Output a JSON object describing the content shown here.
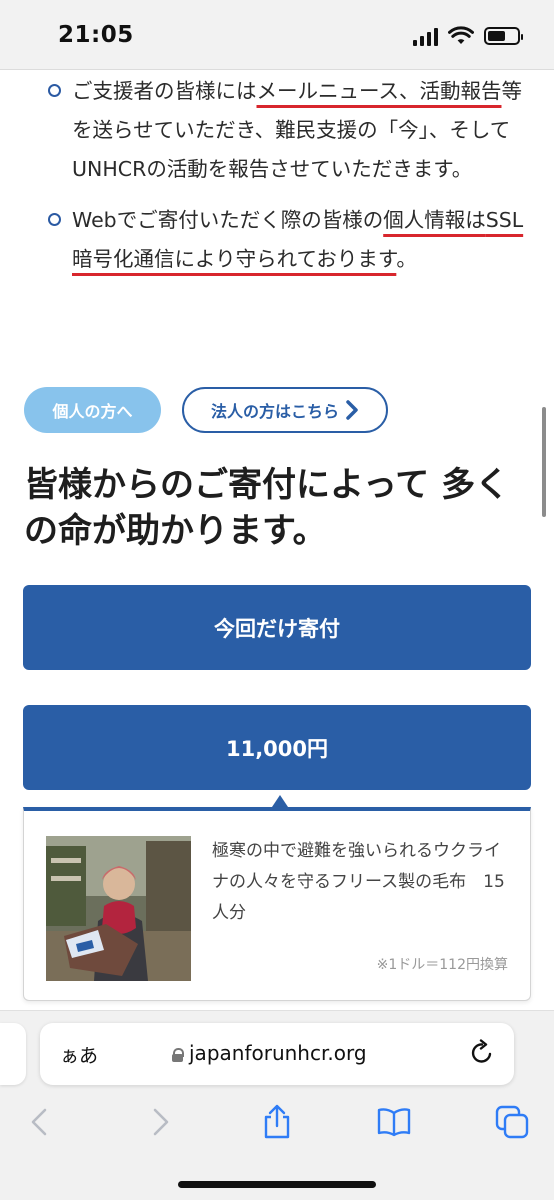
{
  "status_bar": {
    "time": "21:05"
  },
  "bullets": [
    {
      "parts": [
        {
          "text": "ご支援者の皆様には",
          "underline": false
        },
        {
          "text": "メールニュース、活動報告",
          "underline": true
        },
        {
          "text": "等を送らせていただき、難民支援の「今」、そしてUNHCRの活動を報告させていただきます。",
          "underline": false
        }
      ]
    },
    {
      "parts": [
        {
          "text": "Webでご寄付いただく際の皆様の",
          "underline": false
        },
        {
          "text": "個人情報は",
          "underline": true
        },
        {
          "text": "SSL暗号化通信により守られております",
          "underline": true
        },
        {
          "text": "。",
          "underline": false
        }
      ]
    }
  ],
  "tabs": {
    "personal": "個人の方へ",
    "corporate": "法人の方はこちら"
  },
  "headline": "皆様からのご寄付によって 多くの命が助かります。",
  "buttons": {
    "one_time": "今回だけ寄付",
    "amount": "11,000円"
  },
  "impact": {
    "description": "極寒の中で避難を強いられるウクライナの人々を守るフリース製の毛布　15人分",
    "note": "※1ドル＝112円換算"
  },
  "browser": {
    "text_size_label": "ぁあ",
    "url": "japanforunhcr.org"
  },
  "colors": {
    "brand_blue": "#2a5ea6",
    "light_blue": "#88c3ec",
    "underline_red": "#d8262d"
  }
}
